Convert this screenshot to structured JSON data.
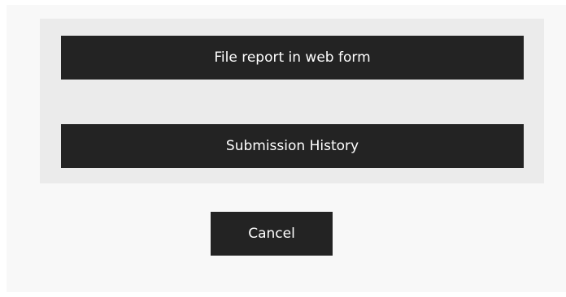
{
  "dialog": {
    "options": {
      "file_report_label": "File report in web form",
      "submission_history_label": "Submission History"
    },
    "cancel_label": "Cancel"
  },
  "colors": {
    "button_bg": "#232323",
    "button_text": "#ffffff",
    "panel_bg": "#ebebeb",
    "dialog_bg": "#f8f8f8"
  }
}
